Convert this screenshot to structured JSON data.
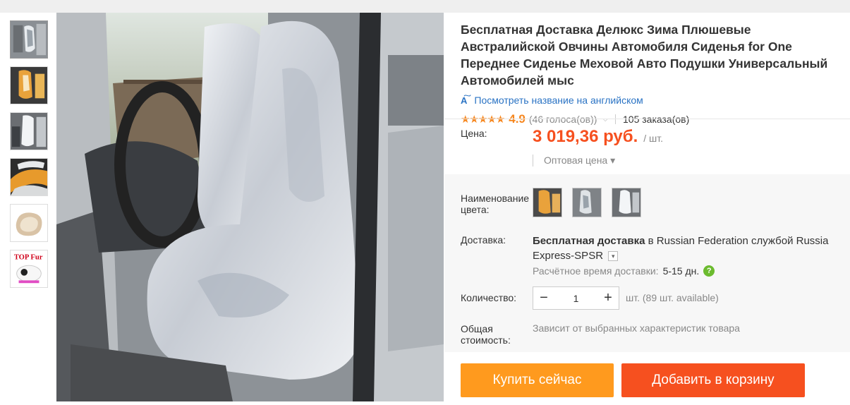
{
  "product": {
    "title": "Бесплатная Доставка Делюкс Зима Плюшевые Австралийской Овчины Автомобиля Сиденья for One Переднее Сиденье Меховой Авто Подушки Универсальный Автомобилей мыс",
    "translate_link": "Посмотреть название на английском",
    "translate_icon": "translate-icon",
    "rating_score": "4.9",
    "rating_stars": "★★★★★",
    "votes": "(46 голоса(ов))",
    "orders": "105 заказа(ов)"
  },
  "price": {
    "label": "Цена:",
    "amount": "3 019,36 руб.",
    "unit": "/ шт.",
    "wholesale": "Оптовая цена ▾"
  },
  "color": {
    "label": "Наименование цвета:",
    "options": [
      "beige-orange",
      "grey-white",
      "white-grey"
    ]
  },
  "shipping": {
    "label": "Доставка:",
    "text_bold": "Бесплатная доставка",
    "text_rest": " в Russian Federation службой Russia Express-SPSR",
    "eta_label": "Расчётное время доставки:",
    "eta_days": "5-15 дн."
  },
  "quantity": {
    "label": "Количество:",
    "value": "1",
    "minus": "−",
    "plus": "+",
    "available": "шт. (89 шт. available)"
  },
  "total": {
    "label": "Общая стоимость:",
    "value": "Зависит от выбранных характеристик товара"
  },
  "actions": {
    "buy_now": "Купить сейчас",
    "add_to_cart": "Добавить в корзину"
  },
  "thumbnails": [
    {
      "name": "grey-seat"
    },
    {
      "name": "orange-seat"
    },
    {
      "name": "white-seat"
    },
    {
      "name": "fur-detail"
    },
    {
      "name": "sheepskin"
    },
    {
      "name": "top-fur-logo",
      "text": "TOP Fur"
    }
  ],
  "colors": {
    "accent_orange": "#f6501f",
    "buy_orange": "#ff9a1e",
    "link_blue": "#2a73c4",
    "star_orange": "#f6871f"
  }
}
